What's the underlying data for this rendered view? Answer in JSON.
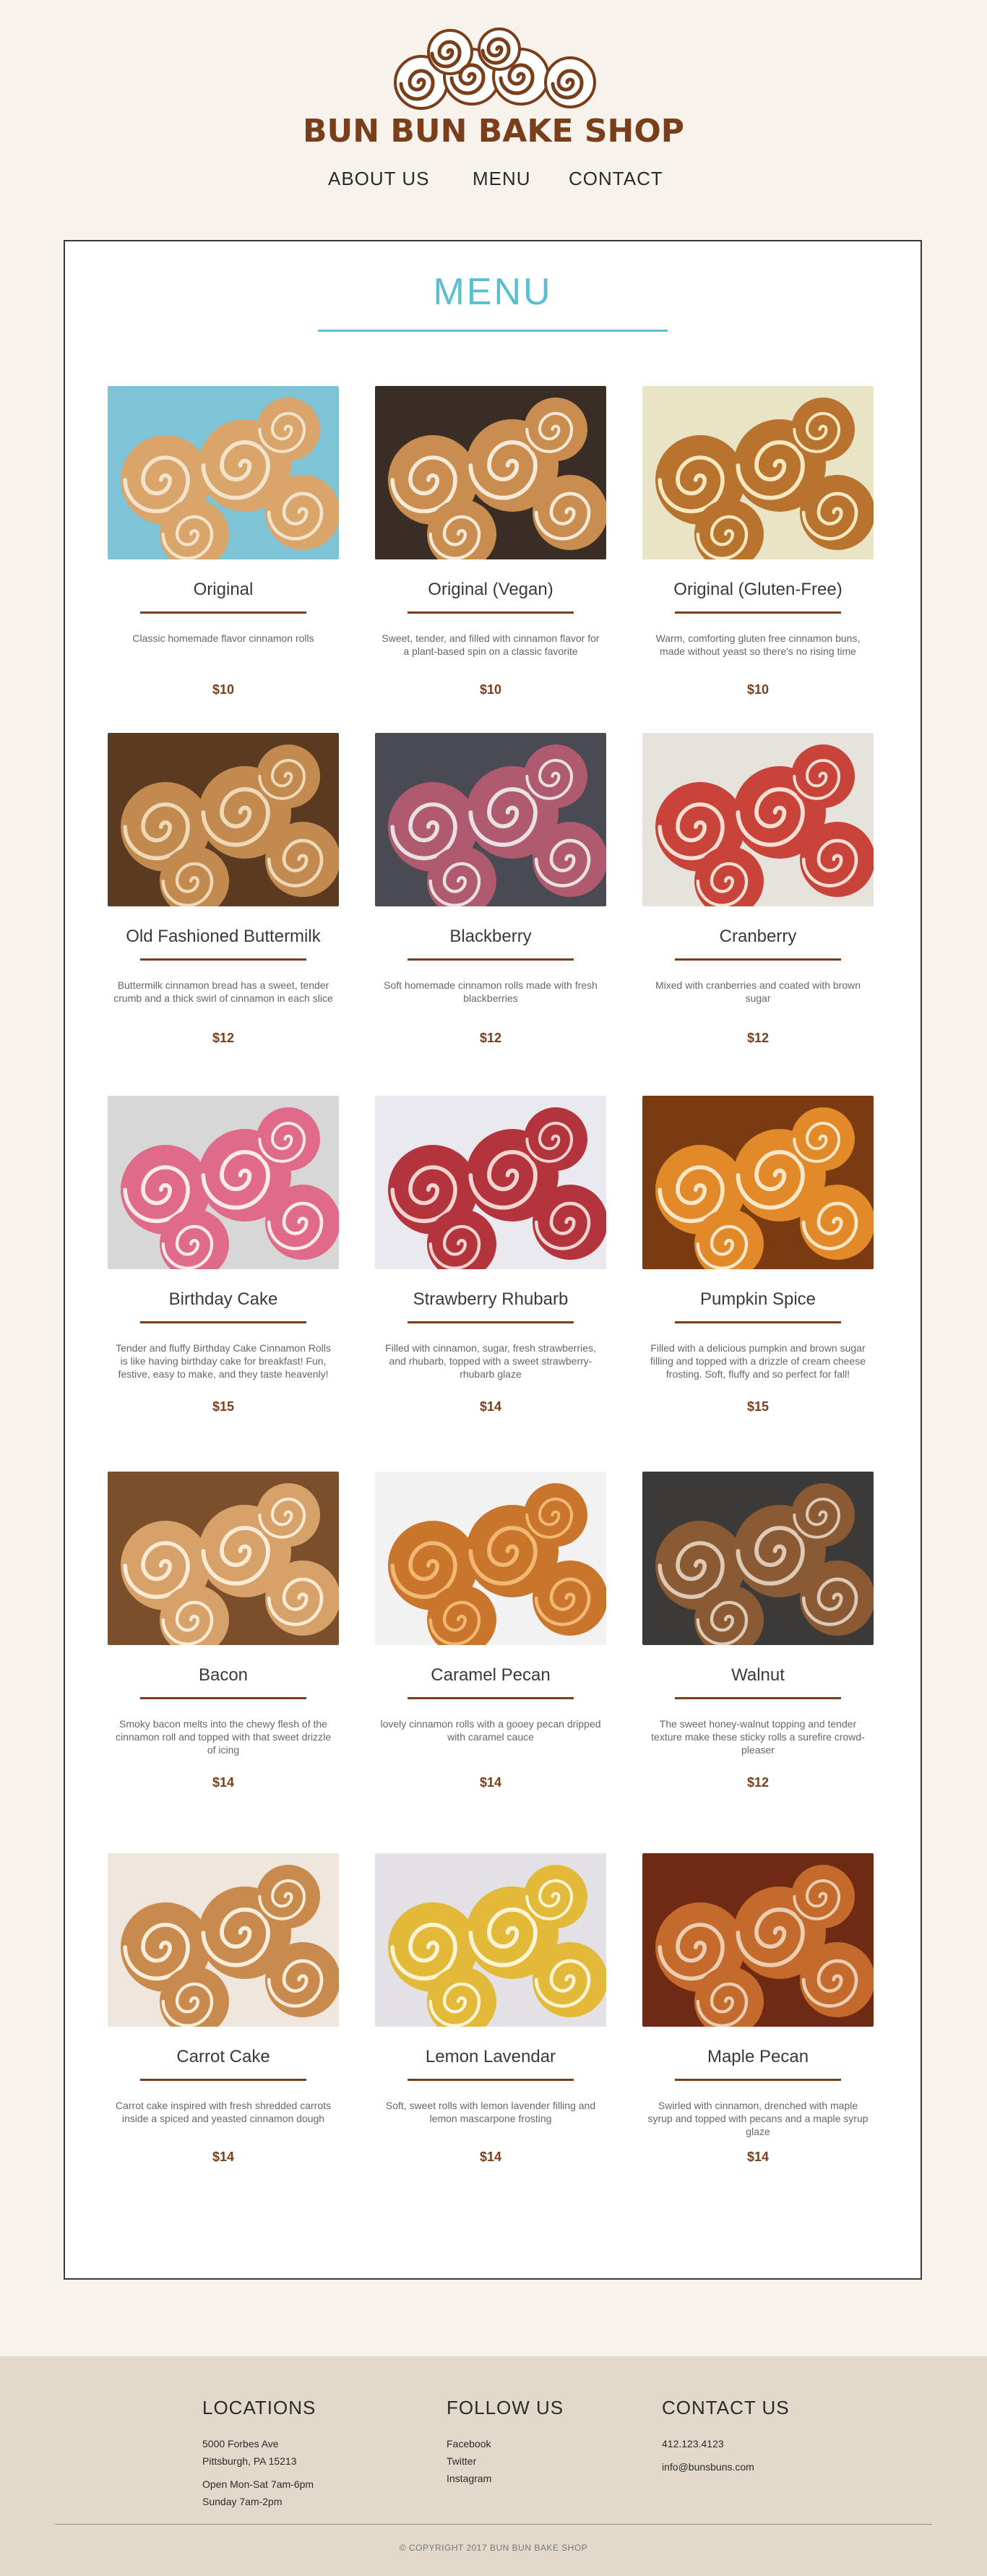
{
  "brand": {
    "name": "BUN BUN BAKE SHOP",
    "logo_icon": "cinnamon-buns-icon"
  },
  "nav": {
    "about": "ABOUT US",
    "menu": "MENU",
    "contact": "CONTACT"
  },
  "menu": {
    "title": "MENU",
    "items": [
      {
        "name": "Original",
        "desc": "Classic homemade flavor cinnamon rolls",
        "price": "$10"
      },
      {
        "name": "Original (Vegan)",
        "desc": "Sweet, tender, and filled with cinnamon flavor for a plant-based spin on a classic favorite",
        "price": "$10"
      },
      {
        "name": "Original (Gluten-Free)",
        "desc": "Warm, comforting gluten free cinnamon buns, made without yeast so there's no rising time",
        "price": "$10"
      },
      {
        "name": "Old Fashioned Buttermilk",
        "desc": "Buttermilk cinnamon bread has a sweet, tender crumb and a thick swirl of cinnamon in each slice",
        "price": "$12"
      },
      {
        "name": "Blackberry",
        "desc": "Soft homemade cinnamon rolls made with fresh blackberries",
        "price": "$12"
      },
      {
        "name": "Cranberry",
        "desc": "Mixed with cranberries and coated with brown sugar",
        "price": "$12"
      },
      {
        "name": "Birthday Cake",
        "desc": "Tender and fluffy Birthday Cake Cinnamon Rolls is like having birthday cake for breakfast! Fun, festive, easy to make, and they taste heavenly!",
        "price": "$15"
      },
      {
        "name": "Strawberry Rhubarb",
        "desc": "Filled with cinnamon, sugar, fresh strawberries, and rhubarb, topped with a sweet strawberry-rhubarb glaze",
        "price": "$14"
      },
      {
        "name": "Pumpkin Spice",
        "desc": "Filled with a delicious pumpkin and brown sugar filling and topped with a drizzle of cream cheese frosting. Soft, fluffy and so perfect for fall!",
        "price": "$15"
      },
      {
        "name": "Bacon",
        "desc": "Smoky bacon melts into the chewy flesh of the cinnamon roll and topped with that sweet drizzle of icing",
        "price": "$14"
      },
      {
        "name": "Caramel Pecan",
        "desc": "lovely cinnamon rolls with a gooey pecan dripped with caramel cauce",
        "price": "$14"
      },
      {
        "name": "Walnut",
        "desc": "The sweet honey-walnut topping and tender texture make these sticky rolls a surefire crowd-pleaser",
        "price": "$12"
      },
      {
        "name": "Carrot Cake",
        "desc": "Carrot cake inspired with fresh shredded carrots inside a spiced and yeasted cinnamon dough",
        "price": "$14"
      },
      {
        "name": "Lemon Lavendar",
        "desc": "Soft, sweet rolls with lemon lavender filling and lemon mascarpone frosting",
        "price": "$14"
      },
      {
        "name": "Maple Pecan",
        "desc": "Swirled with cinnamon, drenched with maple syrup and topped with pecans and a maple syrup glaze",
        "price": "$14"
      }
    ]
  },
  "footer": {
    "locations": {
      "title": "LOCATIONS",
      "address1": "5000 Forbes Ave",
      "address2": "Pittsburgh, PA 15213",
      "hours1": "Open Mon-Sat 7am-6pm",
      "hours2": "Sunday 7am-2pm"
    },
    "follow": {
      "title": "FOLLOW US",
      "facebook": "Facebook",
      "twitter": "Twitter",
      "instagram": "Instagram"
    },
    "contact": {
      "title": "CONTACT US",
      "phone": "412.123.4123",
      "email": "info@bunsbuns.com"
    },
    "copyright": "© COPYRIGHT 2017 BUN BUN BAKE SHOP"
  },
  "colors": {
    "accent": "#5bbfd0",
    "brand": "#7a3f1a",
    "page_bg": "#f7f3ec",
    "footer_bg": "#e2d9cb"
  }
}
